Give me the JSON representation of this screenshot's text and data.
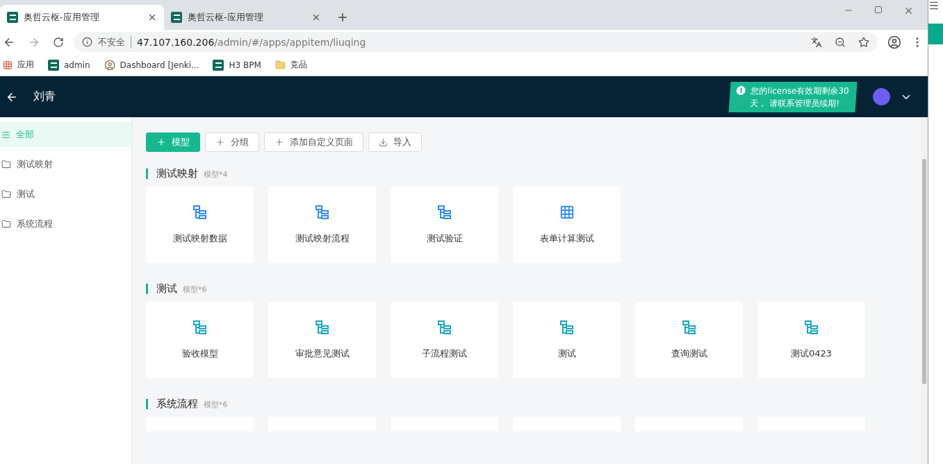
{
  "browser": {
    "tabs": [
      {
        "title": "奥哲云枢-应用管理",
        "selected": true
      },
      {
        "title": "奥哲云枢-应用管理",
        "selected": false
      }
    ],
    "address": {
      "security": "不安全",
      "url_host": "47.107.160.206",
      "url_path": "/admin/#/apps/appitem/liuqing"
    },
    "bookmarks": [
      {
        "kind": "apps",
        "label": "应用"
      },
      {
        "kind": "site",
        "label": "admin"
      },
      {
        "kind": "person",
        "label": "Dashboard [Jenki..."
      },
      {
        "kind": "site",
        "label": "H3 BPM"
      },
      {
        "kind": "folder",
        "label": "竞品"
      }
    ]
  },
  "header": {
    "title": "刘青",
    "notice": "您的license有效期剩余30天， 请联系管理员续期!"
  },
  "sidebar": {
    "items": [
      {
        "kind": "all",
        "label": "全部",
        "selected": true
      },
      {
        "kind": "folder",
        "label": "测试映射",
        "selected": false
      },
      {
        "kind": "folder",
        "label": "测试",
        "selected": false
      },
      {
        "kind": "folder",
        "label": "系统流程",
        "selected": false
      }
    ]
  },
  "toolbar": [
    {
      "kind": "primary",
      "label": "模型"
    },
    {
      "kind": "add",
      "label": "分组"
    },
    {
      "kind": "add",
      "label": "添加自定义页面"
    },
    {
      "kind": "import",
      "label": "导入"
    }
  ],
  "sections": [
    {
      "title": "测试映射",
      "count": "模型*4",
      "cards": [
        {
          "kind": "flow",
          "label": "测试映射数据",
          "color": "#2d8cf0"
        },
        {
          "kind": "flow",
          "label": "测试映射流程",
          "color": "#2d8cf0"
        },
        {
          "kind": "flow",
          "label": "测试验证",
          "color": "#2d8cf0"
        },
        {
          "kind": "table",
          "label": "表单计算测试",
          "color": "#2d8cf0"
        }
      ]
    },
    {
      "title": "测试",
      "count": "模型*6",
      "cards": [
        {
          "kind": "flow",
          "label": "验收模型",
          "color": "#1ba8c6"
        },
        {
          "kind": "flow",
          "label": "审批意见测试",
          "color": "#1ba8c6"
        },
        {
          "kind": "flow",
          "label": "子流程测试",
          "color": "#1ba8c6"
        },
        {
          "kind": "flow",
          "label": "测试",
          "color": "#1ba8c6"
        },
        {
          "kind": "flow",
          "label": "查询测试",
          "color": "#1ba8c6"
        },
        {
          "kind": "flow",
          "label": "测试0423",
          "color": "#1ba8c6"
        }
      ]
    },
    {
      "title": "系统流程",
      "count": "模型*6",
      "cards": [
        {
          "kind": "cut"
        },
        {
          "kind": "cut"
        },
        {
          "kind": "cut"
        },
        {
          "kind": "cut"
        },
        {
          "kind": "cut"
        },
        {
          "kind": "cut"
        }
      ]
    }
  ]
}
